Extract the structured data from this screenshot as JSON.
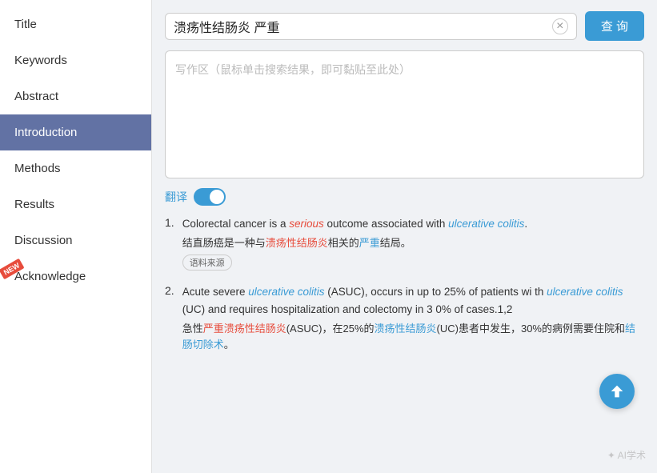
{
  "sidebar": {
    "items": [
      {
        "id": "title",
        "label": "Title",
        "active": false,
        "new": false
      },
      {
        "id": "keywords",
        "label": "Keywords",
        "active": false,
        "new": false
      },
      {
        "id": "abstract",
        "label": "Abstract",
        "active": false,
        "new": false
      },
      {
        "id": "introduction",
        "label": "Introduction",
        "active": true,
        "new": false
      },
      {
        "id": "methods",
        "label": "Methods",
        "active": false,
        "new": false
      },
      {
        "id": "results",
        "label": "Results",
        "active": false,
        "new": false
      },
      {
        "id": "discussion",
        "label": "Discussion",
        "active": false,
        "new": false
      },
      {
        "id": "acknowledge",
        "label": "Acknowledge",
        "active": false,
        "new": true
      }
    ]
  },
  "search": {
    "value": "溃疡性结肠炎 严重",
    "clear_label": "×",
    "query_label": "查 询",
    "placeholder": "写作区（鼠标单击搜索结果，即可黏贴至此处）"
  },
  "translate": {
    "label": "翻译"
  },
  "results": [
    {
      "number": "1.",
      "en_parts": [
        {
          "text": "Colorectal cancer is a ",
          "style": "normal"
        },
        {
          "text": "serious",
          "style": "italic-red"
        },
        {
          "text": " outcome associated with ",
          "style": "normal"
        },
        {
          "text": "ulcerative colitis",
          "style": "italic-blue"
        },
        {
          "text": ".",
          "style": "normal"
        }
      ],
      "zh_parts": [
        {
          "text": "结直肠癌是一种与",
          "style": "normal"
        },
        {
          "text": "溃疡性结肠炎",
          "style": "highlight-red"
        },
        {
          "text": "相关的",
          "style": "normal"
        },
        {
          "text": "严重",
          "style": "highlight-blue"
        },
        {
          "text": "结局。",
          "style": "normal"
        }
      ],
      "source": "语料来源"
    },
    {
      "number": "2.",
      "en_parts": [
        {
          "text": "Acute severe ",
          "style": "normal"
        },
        {
          "text": "ulcerative colitis",
          "style": "italic-blue"
        },
        {
          "text": " (ASUC), occurs in up to 25% of patients wi th ",
          "style": "normal"
        },
        {
          "text": "ulcerative colitis",
          "style": "italic-blue"
        },
        {
          "text": " (UC) and requires hospitalization and colectomy in 3 0% of cases.1,2",
          "style": "normal"
        }
      ],
      "zh_parts": [
        {
          "text": "急性",
          "style": "normal"
        },
        {
          "text": "严重溃疡性结肠炎",
          "style": "highlight-red"
        },
        {
          "text": "(ASUC)，在25%的",
          "style": "normal"
        },
        {
          "text": "溃疡性结肠炎",
          "style": "highlight-blue"
        },
        {
          "text": "(UC)患者中发生，30%的病例需要住院和",
          "style": "normal"
        },
        {
          "text": "结肠切除术",
          "style": "highlight-blue"
        },
        {
          "text": "。",
          "style": "normal"
        }
      ],
      "source": null
    }
  ],
  "watermark": "✦ AI学术",
  "new_badge": "NEW"
}
